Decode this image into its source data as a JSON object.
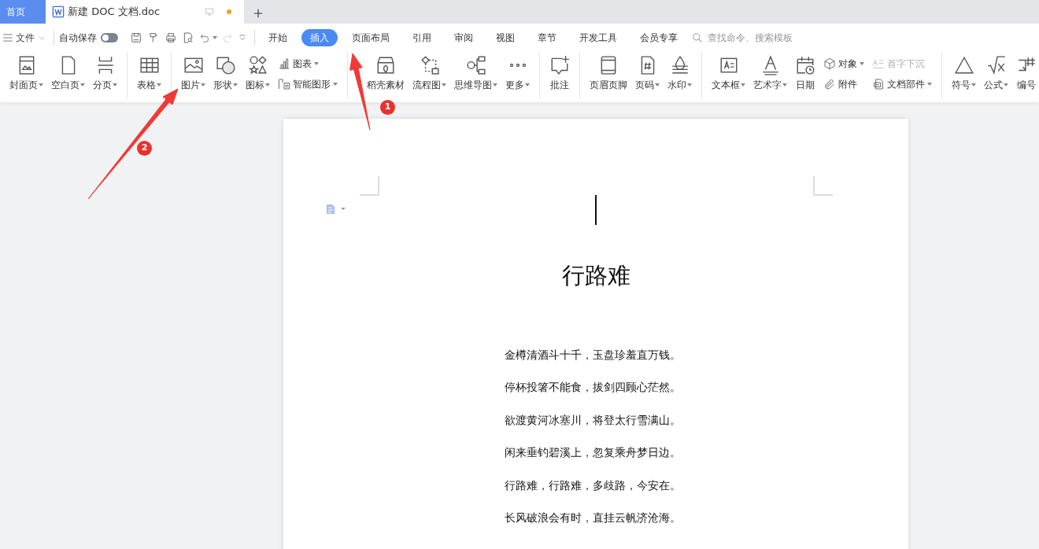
{
  "tabs": [
    {
      "label": "首页",
      "kind": "home",
      "selected": false,
      "modified": false
    },
    {
      "label": "新建 DOC 文档.doc",
      "kind": "doc",
      "selected": true,
      "modified": true
    }
  ],
  "quick_toolbar": {
    "file_label": "文件",
    "autosave_label": "自动保存",
    "autosave_on": false,
    "redo_disabled": true
  },
  "menu_tabs": [
    {
      "label": "开始",
      "selected": false
    },
    {
      "label": "插入",
      "selected": true
    },
    {
      "label": "页面布局",
      "selected": false
    },
    {
      "label": "引用",
      "selected": false
    },
    {
      "label": "审阅",
      "selected": false
    },
    {
      "label": "视图",
      "selected": false
    },
    {
      "label": "章节",
      "selected": false
    },
    {
      "label": "开发工具",
      "selected": false
    },
    {
      "label": "会员专享",
      "selected": false
    }
  ],
  "search": {
    "placeholder": "查找命令、搜索模板"
  },
  "ribbon": {
    "groups": [
      {
        "items": [
          {
            "kind": "large",
            "label": "封面页",
            "dropdown": true
          },
          {
            "kind": "large",
            "label": "空白页",
            "dropdown": true
          },
          {
            "kind": "large",
            "label": "分页",
            "dropdown": true
          }
        ]
      },
      {
        "items": [
          {
            "kind": "large",
            "label": "表格",
            "dropdown": true
          }
        ]
      },
      {
        "items": [
          {
            "kind": "large",
            "label": "图片",
            "dropdown": true
          },
          {
            "kind": "large",
            "label": "形状",
            "dropdown": true
          },
          {
            "kind": "large",
            "label": "图标",
            "dropdown": true
          },
          {
            "kind": "stack",
            "items": [
              {
                "label": "图表",
                "dropdown": true,
                "disabled": false
              },
              {
                "label": "智能图形",
                "dropdown": true,
                "disabled": false
              }
            ]
          }
        ]
      },
      {
        "items": [
          {
            "kind": "large",
            "label": "稻壳素材",
            "dropdown": false
          },
          {
            "kind": "large",
            "label": "流程图",
            "dropdown": true
          },
          {
            "kind": "large",
            "label": "思维导图",
            "dropdown": true
          },
          {
            "kind": "large",
            "label": "更多",
            "dropdown": true
          }
        ]
      },
      {
        "items": [
          {
            "kind": "large",
            "label": "批注",
            "dropdown": false
          }
        ]
      },
      {
        "items": [
          {
            "kind": "large",
            "label": "页眉页脚",
            "dropdown": false
          },
          {
            "kind": "large",
            "label": "页码",
            "dropdown": true
          },
          {
            "kind": "large",
            "label": "水印",
            "dropdown": true
          }
        ]
      },
      {
        "items": [
          {
            "kind": "large",
            "label": "文本框",
            "dropdown": true
          },
          {
            "kind": "large",
            "label": "艺术字",
            "dropdown": true
          },
          {
            "kind": "large",
            "label": "日期",
            "dropdown": false
          },
          {
            "kind": "stack",
            "items": [
              {
                "label": "对象",
                "dropdown": true,
                "disabled": false
              },
              {
                "label": "附件",
                "dropdown": false,
                "disabled": false
              }
            ]
          },
          {
            "kind": "stack",
            "items": [
              {
                "label": "首字下沉",
                "dropdown": false,
                "disabled": true
              },
              {
                "label": "文档部件",
                "dropdown": true,
                "disabled": false
              }
            ]
          }
        ]
      },
      {
        "items": [
          {
            "kind": "large",
            "label": "符号",
            "dropdown": true
          },
          {
            "kind": "large",
            "label": "公式",
            "dropdown": true
          },
          {
            "kind": "large",
            "label": "编号",
            "dropdown": false
          }
        ]
      }
    ]
  },
  "document": {
    "title": "行路难",
    "lines": [
      "金樽清酒斗十千，玉盘珍羞直万钱。",
      "停杯投箸不能食，拔剑四顾心茫然。",
      "欲渡黄河冰塞川，将登太行雪满山。",
      "闲来垂钓碧溪上，忽复乘舟梦日边。",
      "行路难，行路难，多歧路，今安在。",
      "长风破浪会有时，直挂云帆济沧海。"
    ]
  },
  "annotations": [
    {
      "label": "1"
    },
    {
      "label": "2"
    }
  ]
}
